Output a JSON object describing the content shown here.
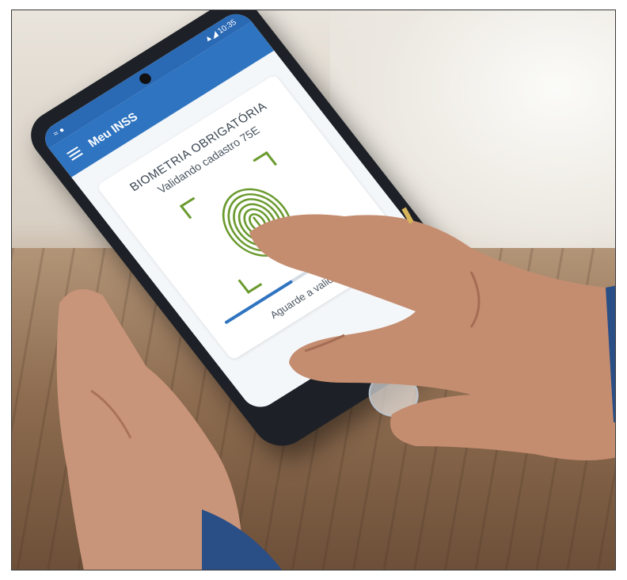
{
  "phone": {
    "status_left": "≈ ●",
    "status_right": "▲◢ 10:35",
    "app_title": "Meu INSS",
    "card_title": "BIOMETRIA OBRIGATÓRIA",
    "card_subtitle": "Validando cadastro 75E",
    "card_hint": "Aguarde a validação",
    "progress": 0.45
  },
  "colors": {
    "app_bar": "#2f74c0",
    "fingerprint": "#6a9a2e",
    "sleeve": "#2a4e86"
  },
  "icons": {
    "menu": "menu-icon",
    "fingerprint": "fingerprint-icon"
  }
}
